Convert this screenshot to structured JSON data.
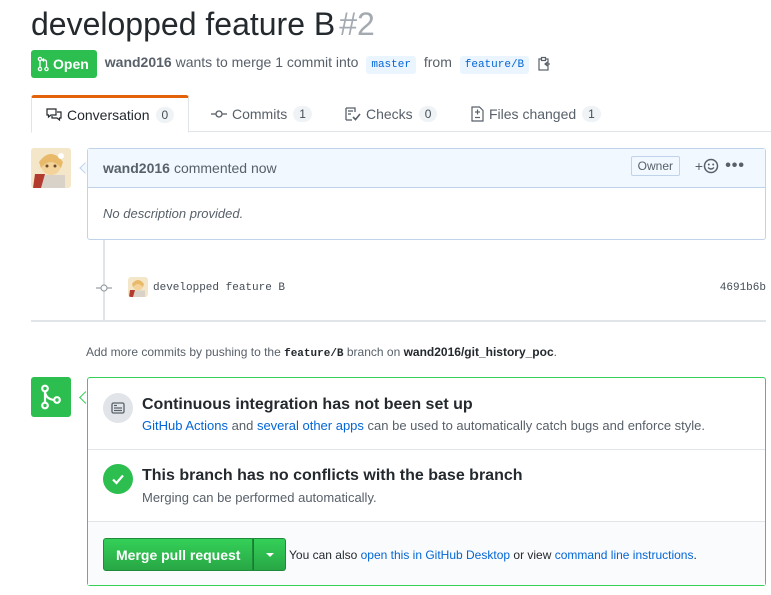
{
  "pr": {
    "title": "developped feature B",
    "number": "#2",
    "state": "Open",
    "author": "wand2016",
    "merge_text": "wants to merge 1 commit into",
    "base_branch": "master",
    "from_text": "from",
    "head_branch": "feature/B"
  },
  "tabs": [
    {
      "label": "Conversation",
      "count": "0",
      "icon": "comment-discussion-icon"
    },
    {
      "label": "Commits",
      "count": "1",
      "icon": "git-commit-icon"
    },
    {
      "label": "Checks",
      "count": "0",
      "icon": "checklist-icon"
    },
    {
      "label": "Files changed",
      "count": "1",
      "icon": "file-diff-icon"
    }
  ],
  "comment": {
    "author": "wand2016",
    "time": "commented now",
    "role": "Owner",
    "body": "No description provided.",
    "more": "•••"
  },
  "commit": {
    "message": "developped feature B",
    "sha": "4691b6b"
  },
  "add_commits": {
    "prefix": "Add more commits by pushing to the",
    "branch": "feature/B",
    "middle": "branch on",
    "repo": "wand2016/git_history_poc",
    "suffix": "."
  },
  "merge_box": {
    "ci_title": "Continuous integration has not been set up",
    "ci_link1": "GitHub Actions",
    "ci_and": "and",
    "ci_link2": "several other apps",
    "ci_rest": "can be used to automatically catch bugs and enforce style.",
    "conflict_title": "This branch has no conflicts with the base branch",
    "conflict_sub": "Merging can be performed automatically.",
    "merge_button": "Merge pull request",
    "note_prefix": "You can also",
    "note_link1": "open this in GitHub Desktop",
    "note_mid": "or view",
    "note_link2": "command line instructions",
    "note_suffix": "."
  },
  "colors": {
    "open_green": "#2cbe4e",
    "link_blue": "#0366d6",
    "tab_accent": "#e36209"
  }
}
